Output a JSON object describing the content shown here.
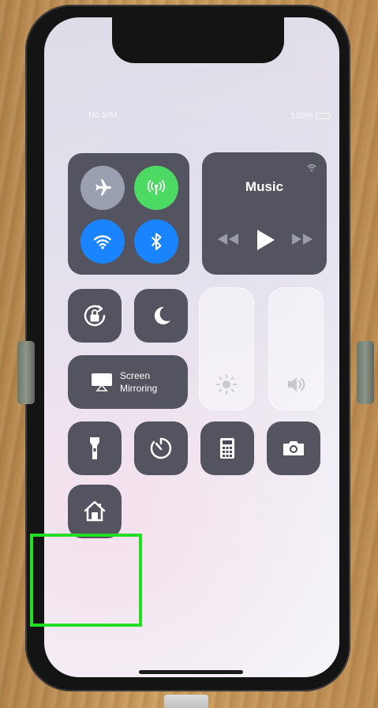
{
  "status_bar": {
    "carrier": "No SIM",
    "battery_text": "100%"
  },
  "connectivity": {
    "airplane_icon": "airplane-icon",
    "cellular_icon": "cellular-data-icon",
    "wifi_icon": "wifi-icon",
    "bluetooth_icon": "bluetooth-icon"
  },
  "music": {
    "title": "Music"
  },
  "controls": {
    "screen_mirroring_line1": "Screen",
    "screen_mirroring_line2": "Mirroring"
  },
  "sliders": {
    "brightness_level": 0.0,
    "volume_level": 0.0
  },
  "colors": {
    "tile_dark": "#464854",
    "active_green": "#4cd964",
    "active_blue": "#1a84ff",
    "highlight_green": "#22dd22"
  }
}
